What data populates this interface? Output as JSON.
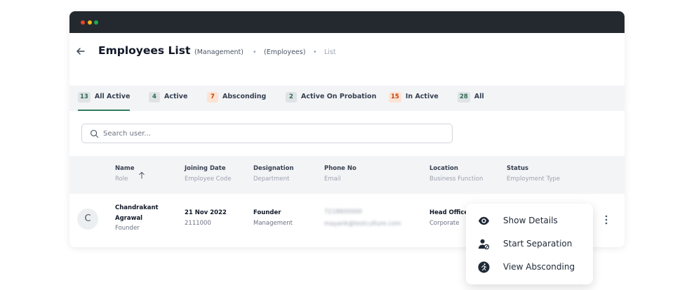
{
  "header": {
    "title": "Employees List",
    "breadcrumbs": [
      "(Management)",
      "(Employees)",
      "List"
    ],
    "separator": "•"
  },
  "tabs": [
    {
      "count": "13",
      "label": "All Active",
      "badge": "gray",
      "active": true
    },
    {
      "count": "4",
      "label": "Active",
      "badge": "green"
    },
    {
      "count": "7",
      "label": "Absconding",
      "badge": "orange"
    },
    {
      "count": "2",
      "label": "Active On Probation",
      "badge": "gray"
    },
    {
      "count": "15",
      "label": "In Active",
      "badge": "orange"
    },
    {
      "count": "28",
      "label": "All",
      "badge": "green"
    }
  ],
  "search": {
    "placeholder": "Search user...",
    "value": ""
  },
  "table": {
    "columns": [
      {
        "primary": "Name",
        "secondary": "Role"
      },
      {
        "primary": "Joining Date",
        "secondary": "Employee Code"
      },
      {
        "primary": "Designation",
        "secondary": "Department"
      },
      {
        "primary": "Phone No",
        "secondary": "Email"
      },
      {
        "primary": "Location",
        "secondary": "Business Function"
      },
      {
        "primary": "Status",
        "secondary": "Employment Type"
      }
    ],
    "rows": [
      {
        "avatar": "C",
        "name_line1": "Chandrakant",
        "name_line2": "Agrawal",
        "role": "Founder",
        "joining_date": "21 Nov 2022",
        "employee_code": "2111000",
        "designation": "Founder",
        "department": "Management",
        "phone": "7218600000",
        "email": "mayank@testculture.com",
        "location": "Head Office",
        "business_function": "Corporate"
      }
    ]
  },
  "menu": {
    "items": [
      {
        "label": "Show Details",
        "icon": "eye-icon"
      },
      {
        "label": "Start Separation",
        "icon": "user-block-icon"
      },
      {
        "label": "View Absconding",
        "icon": "running-person-icon"
      }
    ]
  },
  "colors": {
    "titlebar": "#24292f",
    "accent": "#2e7d5b",
    "orange_badge": "#fde3d3"
  }
}
